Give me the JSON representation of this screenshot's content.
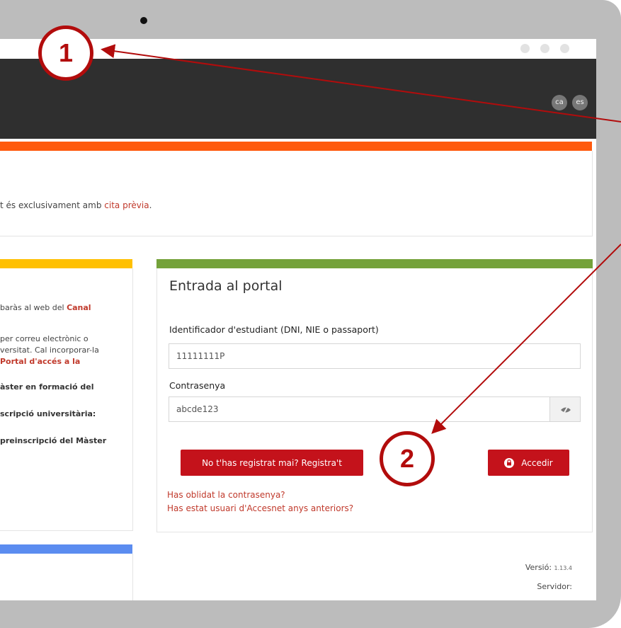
{
  "languages": [
    "ca",
    "es"
  ],
  "notice": {
    "prefix": "t és exclusivament amb",
    "link": "cita prèvia",
    "suffix": "."
  },
  "left_panel": {
    "line1_prefix": "baràs al web del",
    "line1_link": "Canal",
    "line2": "per correu electrònic o",
    "line3": "versitat. Cal incorporar-la",
    "line4_link": "Portal d'accés a la",
    "line5": "àster en formació del",
    "line6": "scripció universitària:",
    "line7": "preinscripció del Màster"
  },
  "login": {
    "title": "Entrada al portal",
    "id_label": "Identificador d'estudiant (DNI, NIE o passaport)",
    "id_value": "11111111P",
    "password_label": "Contrasenya",
    "password_value": "abcde123",
    "register_button": "No t'has registrat mai? Registra't",
    "login_button": "Accedir",
    "forgot_password": "Has oblidat la contrasenya?",
    "previous_user": "Has estat usuari d'Accesnet anys anteriors?"
  },
  "footer": {
    "version_label": "Versió:",
    "version_value": "1.13.4",
    "server_label": "Servidor:"
  },
  "annotations": [
    "1",
    "2"
  ],
  "colors": {
    "accent_red": "#c4121b",
    "orange_bar": "#ff5a0d",
    "yellow_bar": "#ffc000",
    "green_bar": "#74a23a",
    "blue_bar": "#5b8cf0",
    "header": "#2f2f2f"
  }
}
